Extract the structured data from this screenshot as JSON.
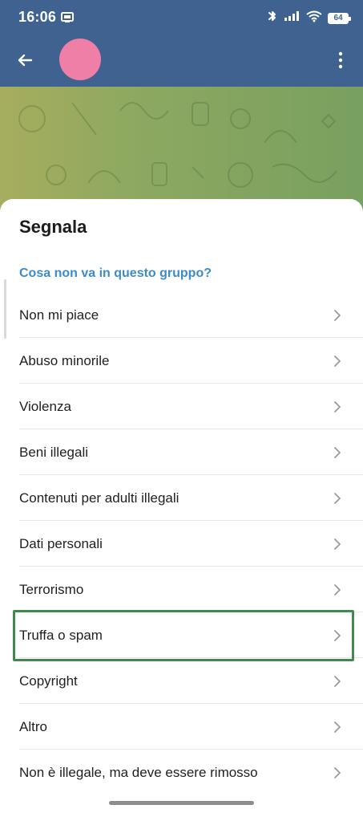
{
  "status_bar": {
    "time": "16:06",
    "battery": "64",
    "icons": [
      "notification-icon",
      "bluetooth-icon",
      "signal-icon",
      "wifi-icon",
      "battery-icon"
    ]
  },
  "app_bar": {
    "back_icon": "arrow-left-icon",
    "menu_icon": "more-vert-icon",
    "avatar_color": "#ef7fa6",
    "bar_color": "#3f6291"
  },
  "sheet": {
    "title": "Segnala",
    "section_title": "Cosa non va in questo gruppo?",
    "accent_color": "#3c8ccc",
    "items": [
      {
        "label": "Non mi piace"
      },
      {
        "label": "Abuso minorile"
      },
      {
        "label": "Violenza"
      },
      {
        "label": "Beni illegali"
      },
      {
        "label": "Contenuti per adulti illegali"
      },
      {
        "label": "Dati personali"
      },
      {
        "label": "Terrorismo"
      },
      {
        "label": "Truffa o spam"
      },
      {
        "label": "Copyright"
      },
      {
        "label": "Altro"
      },
      {
        "label": "Non è illegale, ma deve essere rimosso"
      }
    ],
    "highlight_color": "#3f8a4f"
  }
}
